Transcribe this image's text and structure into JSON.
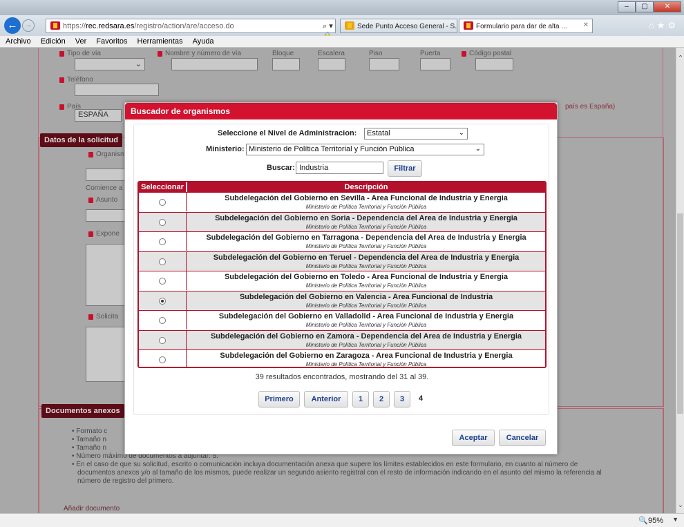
{
  "browser": {
    "address": {
      "scheme": "https://",
      "host": "rec.redsara.es",
      "path": "/registro/action/are/acceso.do",
      "tools": "⌕ ▾ 🔒 C"
    },
    "tabs": [
      {
        "label": "Sede Punto Acceso General - S...",
        "active": false
      },
      {
        "label": "Formulario para dar de alta ...",
        "active": true,
        "close": "✕"
      }
    ],
    "menu": [
      "Archivo",
      "Edición",
      "Ver",
      "Favoritos",
      "Herramientas",
      "Ayuda"
    ],
    "zoom": "95%",
    "window_buttons": [
      "–",
      "▢",
      "✕"
    ]
  },
  "form": {
    "address_labels": {
      "tipo_via": "Tipo de vía",
      "nombre_via": "Nombre y número de vía",
      "bloque": "Bloque",
      "escalera": "Escalera",
      "piso": "Piso",
      "puerta": "Puerta",
      "codigo_postal": "Código postal"
    },
    "telefono_label": "Teléfono",
    "pais_label": "País",
    "pais_value": "ESPAÑA",
    "pais_hint": "país es España)",
    "datos_title": "Datos de la solicitud",
    "organismo_label": "Organism",
    "comience_label": "Comience a",
    "asunto_label": "Asunto",
    "expone_label": "Expone",
    "solicita_label": "Solicita",
    "docs_title": "Documentos anexos",
    "docs_notes": [
      "Formato c",
      "Tamaño n",
      "Tamaño n",
      "Número máximo de documentos a adjuntar: 5.",
      "En el caso de que su solicitud, escrito o comunicación incluya documentación anexa que supere los límites establecidos en este formulario, en cuanto al número de",
      "documentos anexos y/o al tamaño de los mismos, puede realizar un segundo asiento registral con el resto de información indicando en el asunto del mismo la referencia al",
      "número de registro del primero."
    ],
    "add_doc": "Añadir documento"
  },
  "modal": {
    "title": "Buscador de organismos",
    "nivel_label": "Seleccione el Nivel de Administracion:",
    "nivel_value": "Estatal",
    "ministerio_label": "Ministerio:",
    "ministerio_value": "Ministerio de Política Territorial y Función Pública",
    "buscar_label": "Buscar:",
    "buscar_value": "Industria",
    "filtrar": "Filtrar",
    "col_select": "Seleccionar",
    "col_desc": "Descripción",
    "rows": [
      {
        "name": "Subdelegación del Gobierno en Sevilla - Area Funcional de Industria y Energia",
        "ministry": "Ministerio de Política Territorial y Función Pública",
        "selected": false
      },
      {
        "name": "Subdelegación del Gobierno en Soria - Dependencia del Area de Industria y Energia",
        "ministry": "Ministerio de Política Territorial y Función Pública",
        "selected": false
      },
      {
        "name": "Subdelegación del Gobierno en Tarragona - Dependencia del Area de Industria y Energia",
        "ministry": "Ministerio de Política Territorial y Función Pública",
        "selected": false
      },
      {
        "name": "Subdelegación del Gobierno en Teruel - Dependencia del Area de Industria y Energia",
        "ministry": "Ministerio de Política Territorial y Función Pública",
        "selected": false
      },
      {
        "name": "Subdelegación del Gobierno en Toledo - Area Funcional de Industria y Energia",
        "ministry": "Ministerio de Política Territorial y Función Pública",
        "selected": false
      },
      {
        "name": "Subdelegación del Gobierno en Valencia - Area Funcional de Industria",
        "ministry": "Ministerio de Política Territorial y Función Pública",
        "selected": true
      },
      {
        "name": "Subdelegación del Gobierno en Valladolid - Area Funcional de Industria y Energia",
        "ministry": "Ministerio de Política Territorial y Función Pública",
        "selected": false
      },
      {
        "name": "Subdelegación del Gobierno en Zamora - Dependencia del Area de Industria y Energia",
        "ministry": "Ministerio de Política Territorial y Función Pública",
        "selected": false
      },
      {
        "name": "Subdelegación del Gobierno en Zaragoza - Area Funcional de Industria y Energia",
        "ministry": "Ministerio de Política Territorial y Función Pública",
        "selected": false
      }
    ],
    "result_text": "39 resultados encontrados, mostrando del 31 al 39.",
    "pager": {
      "first": "Primero",
      "prev": "Anterior",
      "pages": [
        "1",
        "2",
        "3"
      ],
      "current": "4"
    },
    "aceptar": "Aceptar",
    "cancelar": "Cancelar"
  }
}
